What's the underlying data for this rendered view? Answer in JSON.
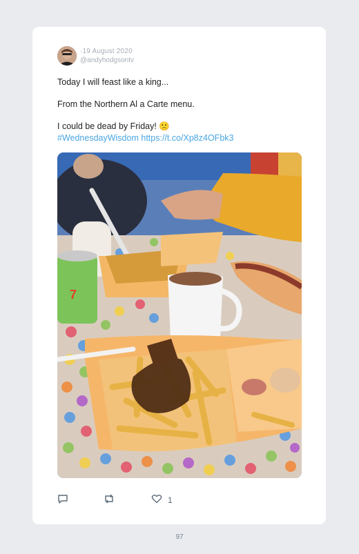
{
  "tweet": {
    "date": "19 August 2020",
    "handle": "@andyhodgsontv",
    "lines": [
      "Today I will feast like a king...",
      "From the Northern Al a Carte menu.",
      "I could be dead by Friday!"
    ],
    "emoji": "🙁",
    "hashtag": "#WednesdayWisdom",
    "url": "https://t.co/Xp8z4OFbk3",
    "photo_description": "",
    "likes": "1"
  },
  "icons": [
    "reply-icon",
    "retweet-icon",
    "heart-icon"
  ],
  "page_number": "97"
}
